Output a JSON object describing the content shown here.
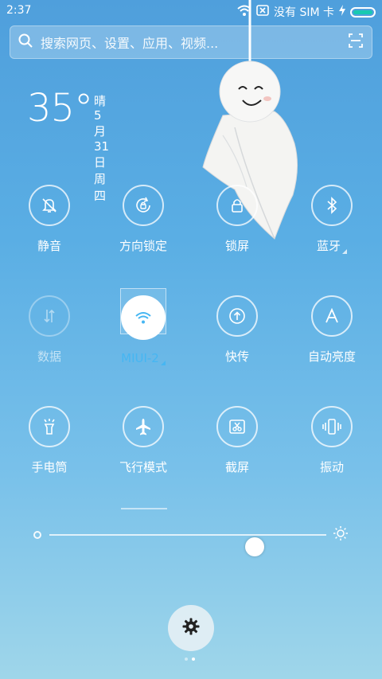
{
  "status_bar": {
    "time": "2:37",
    "carrier": "没有 SIM 卡"
  },
  "search": {
    "placeholder": "搜索网页、设置、应用、视频..."
  },
  "weather": {
    "temperature": "35°",
    "condition": "晴",
    "date": "5月31日 周四"
  },
  "tiles": [
    {
      "label": "静音",
      "icon": "bell-off-icon",
      "state": "normal"
    },
    {
      "label": "方向锁定",
      "icon": "rotation-lock-icon",
      "state": "normal"
    },
    {
      "label": "锁屏",
      "icon": "lock-icon",
      "state": "normal"
    },
    {
      "label": "蓝牙",
      "icon": "bluetooth-icon",
      "state": "normal"
    },
    {
      "label": "数据",
      "icon": "data-arrows-icon",
      "state": "disabled"
    },
    {
      "label": "MIUI-2",
      "icon": "wifi-icon",
      "state": "active"
    },
    {
      "label": "快传",
      "icon": "quick-share-icon",
      "state": "normal"
    },
    {
      "label": "自动亮度",
      "icon": "auto-brightness-icon",
      "state": "normal"
    },
    {
      "label": "手电筒",
      "icon": "flashlight-icon",
      "state": "normal"
    },
    {
      "label": "飞行模式",
      "icon": "airplane-icon",
      "state": "normal"
    },
    {
      "label": "截屏",
      "icon": "screenshot-icon",
      "state": "normal"
    },
    {
      "label": "振动",
      "icon": "vibrate-icon",
      "state": "normal"
    }
  ],
  "brightness": {
    "level": 0.74
  },
  "pager": {
    "pages": 2,
    "current": 1
  },
  "colors": {
    "active_label": "#46b6f2",
    "battery": "#19c9b1"
  }
}
